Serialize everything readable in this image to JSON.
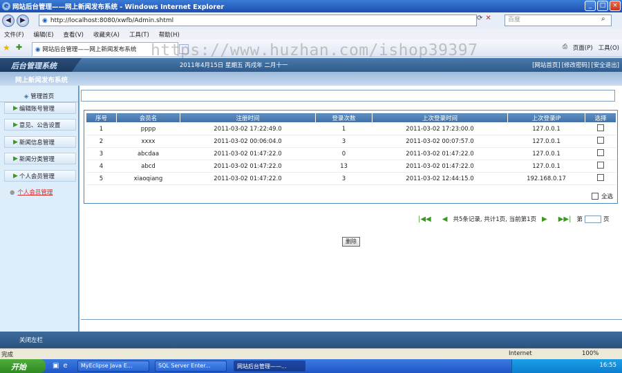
{
  "browser": {
    "title": "网站后台管理——网上新闻发布系统 - Windows Internet Explorer",
    "address": "http://localhost:8080/xwfb/Admin.shtml",
    "search_placeholder": "百度",
    "menu": [
      "文件(F)",
      "编辑(E)",
      "查看(V)",
      "收藏夹(A)",
      "工具(T)",
      "帮助(H)"
    ],
    "tab_title": "网站后台管理——网上新闻发布系统",
    "tools": [
      "页面(P)",
      "工具(O)"
    ],
    "status": "完成",
    "zone": "Internet",
    "zoom": "100%"
  },
  "watermark": "https://www.huzhan.com/ishop39397",
  "header": {
    "logo": "后台管理系统",
    "date": "2011年4月15日 星期五 丙戌年 二月十一",
    "links": [
      "[网站首页]",
      "[修改密码]",
      "[安全退出]"
    ],
    "system_title": "网上新闻发布系统"
  },
  "sidebar": {
    "home": "管理首页",
    "items": [
      "编辑账号管理",
      "意见、公告设置",
      "新闻信息管理",
      "新闻分类管理",
      "个人会员管理"
    ],
    "sub": "个人会员管理"
  },
  "table": {
    "headers": [
      "序号",
      "会员名",
      "注册时间",
      "登录次数",
      "上次登录时间",
      "上次登录IP",
      "选择"
    ],
    "rows": [
      [
        "1",
        "pppp",
        "2011-03-02 17:22:49.0",
        "1",
        "2011-03-02 17:23:00.0",
        "127.0.0.1"
      ],
      [
        "2",
        "xxxx",
        "2011-03-02 00:06:04.0",
        "3",
        "2011-03-02 00:07:57.0",
        "127.0.0.1"
      ],
      [
        "3",
        "abcdaa",
        "2011-03-02 01:47:22.0",
        "0",
        "2011-03-02 01:47:22.0",
        "127.0.0.1"
      ],
      [
        "4",
        "abcd",
        "2011-03-02 01:47:22.0",
        "13",
        "2011-03-02 01:47:22.0",
        "127.0.0.1"
      ],
      [
        "5",
        "xiaoqiang",
        "2011-03-02 01:47:22.0",
        "3",
        "2011-03-02 12:44:15.0",
        "192.168.0.17"
      ]
    ],
    "select_all": "全选"
  },
  "pager": {
    "summary": "共5条记录, 共计1页, 当前第1页",
    "page_label": "第",
    "go_label": "页"
  },
  "actions": {
    "delete": "删除"
  },
  "footer": {
    "close_nav": "关闭左栏"
  },
  "taskbar": {
    "start": "开始",
    "buttons": [
      "MyEclipse Java E...",
      "SQL Server Enter...",
      "网站后台管理——..."
    ],
    "clock": "16:55"
  }
}
